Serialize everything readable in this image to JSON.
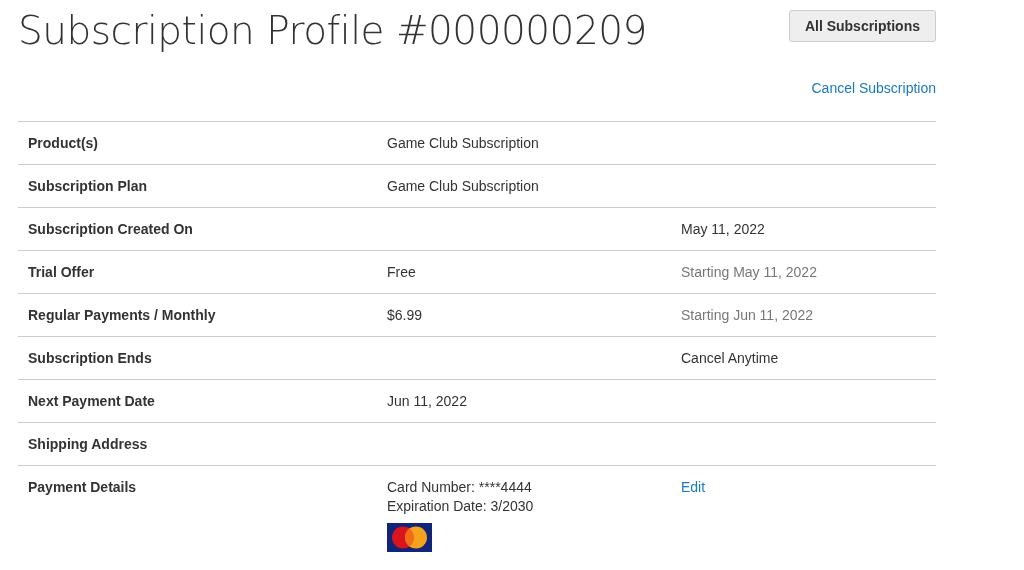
{
  "page_title": "Subscription Profile #000000209",
  "header_button": "All Subscriptions",
  "cancel_link": "Cancel Subscription",
  "rows": [
    {
      "label": "Product(s)",
      "value": [
        "Game Club Subscription"
      ]
    },
    {
      "label": "Subscription Plan",
      "value": [
        "Game Club Subscription"
      ]
    },
    {
      "label": "Subscription Created On",
      "side": {
        "text": "May 11, 2022",
        "kind": "text"
      }
    },
    {
      "label": "Trial Offer",
      "value": [
        "Free"
      ],
      "side": {
        "text": "Starting May 11, 2022",
        "kind": "note"
      }
    },
    {
      "label": "Regular Payments / Monthly",
      "value": [
        "$6.99"
      ],
      "side": {
        "text": "Starting Jun 11, 2022",
        "kind": "note"
      }
    },
    {
      "label": "Subscription Ends",
      "side": {
        "text": "Cancel Anytime",
        "kind": "text"
      }
    },
    {
      "label": "Next Payment Date",
      "value": [
        "Jun 11, 2022"
      ]
    },
    {
      "label": "Shipping Address"
    },
    {
      "label": "Payment Details",
      "value": [
        "Card Number: ****4444",
        "Expiration Date: 3/2030"
      ],
      "card_logo": true,
      "side": {
        "text": "Edit",
        "kind": "link"
      }
    }
  ]
}
